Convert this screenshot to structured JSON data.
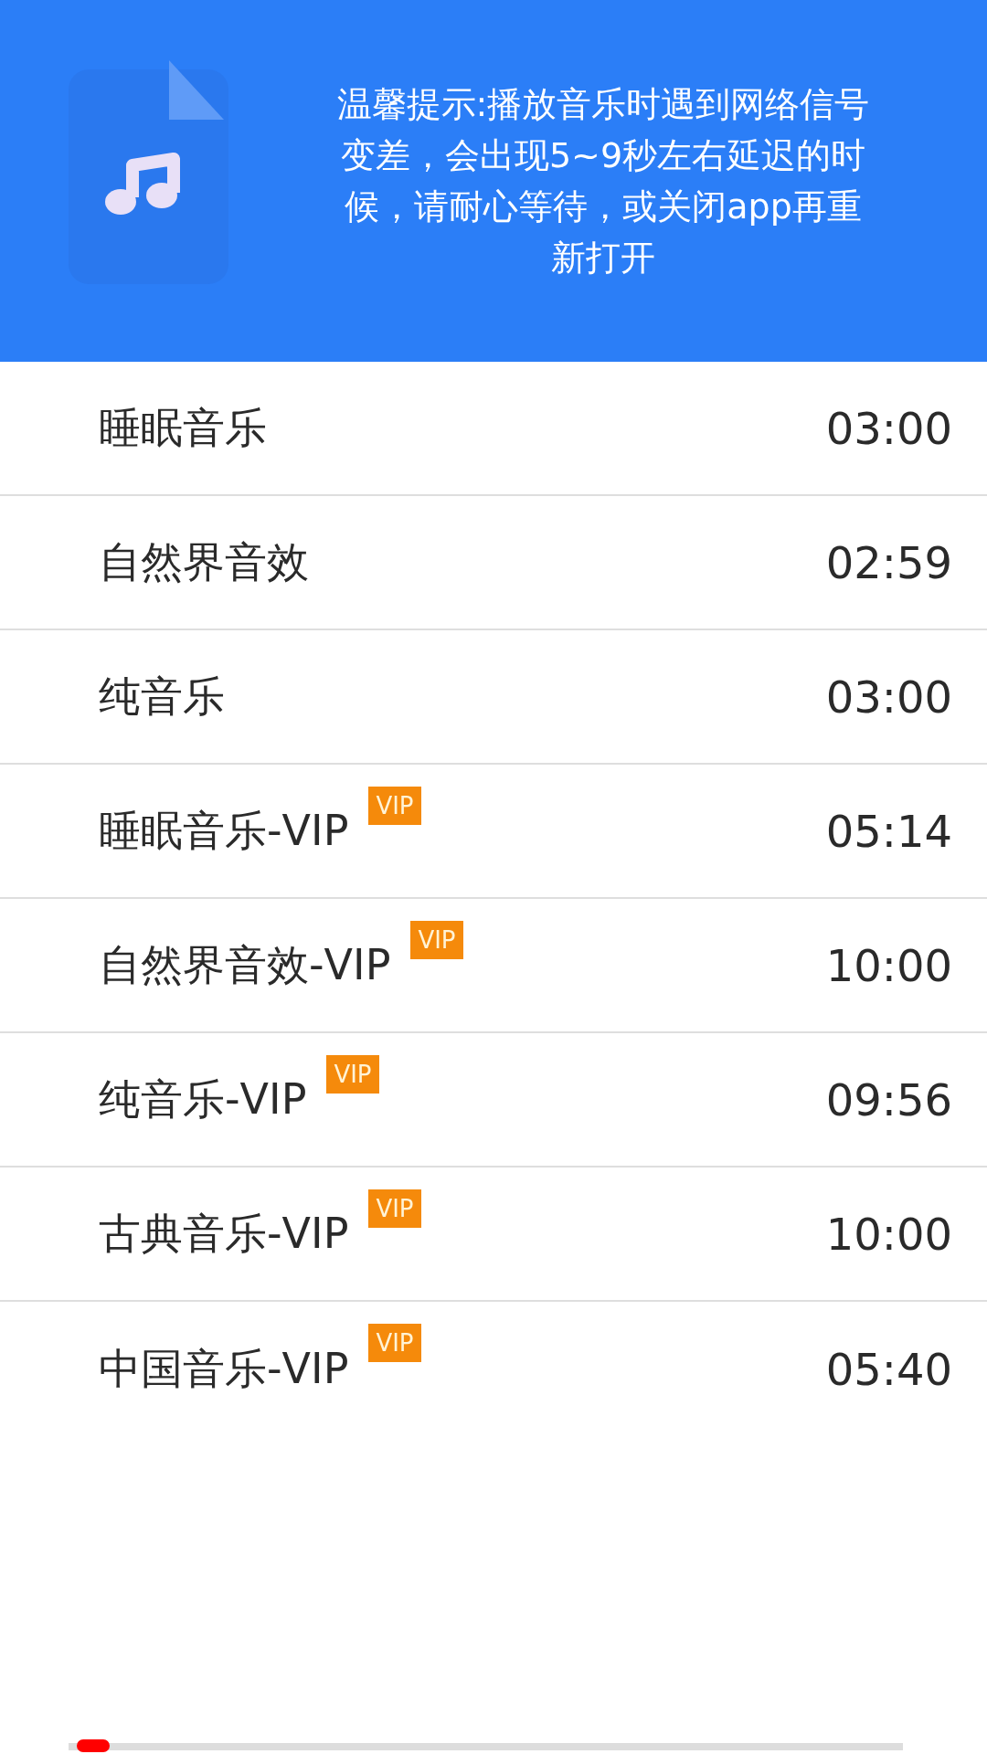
{
  "header": {
    "notice": "温馨提示:播放音乐时遇到网络信号变差，会出现5~9秒左右延迟的时候，请耐心等待，或关闭app再重新打开"
  },
  "tracks": [
    {
      "title": "睡眠音乐",
      "duration": "03:00"
    },
    {
      "title": "自然界音效",
      "duration": "02:59"
    },
    {
      "title": "纯音乐",
      "duration": "03:00"
    },
    {
      "title": "睡眠音乐-VIP",
      "badge": "VIP",
      "duration": "05:14"
    },
    {
      "title": "自然界音效-VIP",
      "badge": "VIP",
      "duration": "10:00"
    },
    {
      "title": "纯音乐-VIP",
      "badge": "VIP",
      "duration": "09:56"
    },
    {
      "title": "古典音乐-VIP",
      "badge": "VIP",
      "duration": "10:00"
    },
    {
      "title": "中国音乐-VIP",
      "badge": "VIP",
      "duration": "05:40"
    }
  ],
  "player": {
    "level": 0.01
  }
}
